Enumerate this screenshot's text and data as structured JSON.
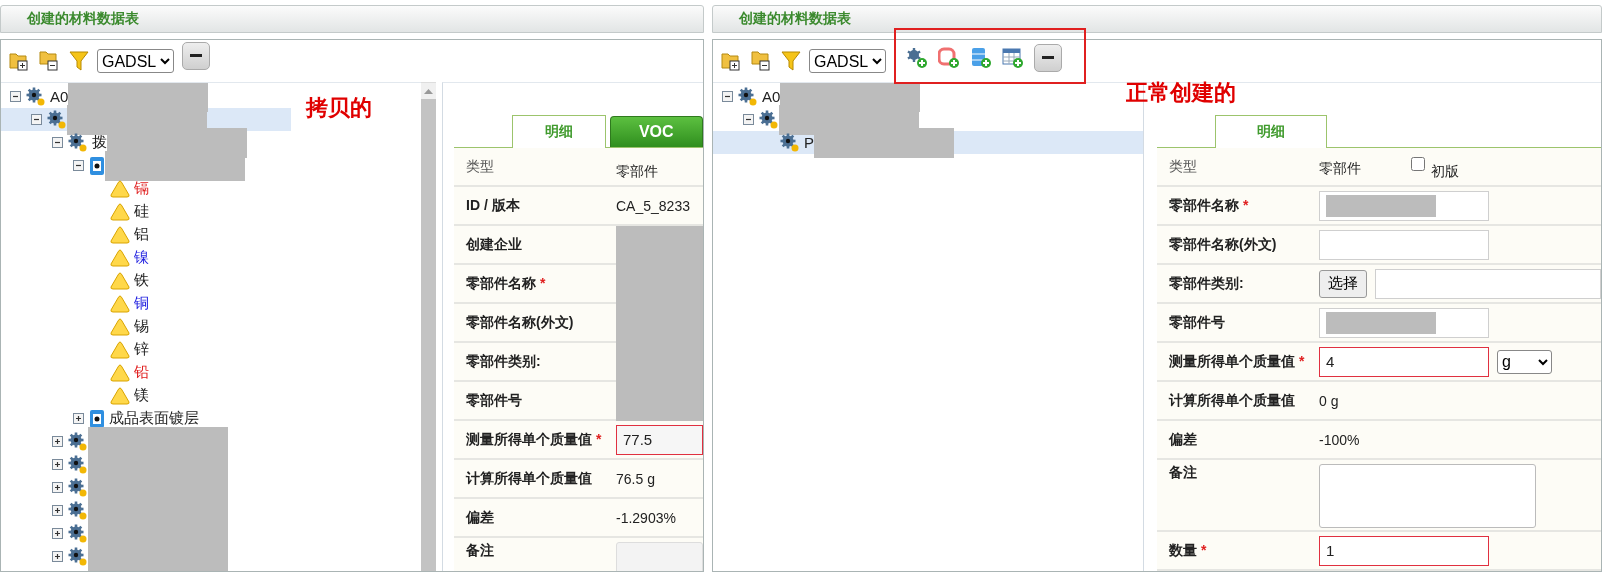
{
  "panels": [
    {
      "title": "创建的材料数据表",
      "toolbar": {
        "standard": "GADSL"
      },
      "annotation": "拷贝的",
      "scrollbar": true,
      "tree": [
        {
          "label": "A0",
          "kind": "assembly",
          "expanded": true,
          "redacted": true,
          "selected": false,
          "children": [
            {
              "kind": "assembly",
              "expanded": true,
              "redacted": true,
              "selected": true,
              "children": [
                {
                  "label": "拨",
                  "kind": "assembly",
                  "expanded": true,
                  "redacted": true,
                  "selected": false,
                  "children": [
                    {
                      "kind": "material",
                      "expanded": true,
                      "redacted": true,
                      "selected": false,
                      "children": [
                        {
                          "label": "镉",
                          "kind": "substance",
                          "color": "#e02020",
                          "selected": false
                        },
                        {
                          "label": "硅",
                          "kind": "substance",
                          "color": "#202020",
                          "selected": false
                        },
                        {
                          "label": "铝",
                          "kind": "substance",
                          "color": "#202020",
                          "selected": false
                        },
                        {
                          "label": "镍",
                          "kind": "substance",
                          "color": "#2020e0",
                          "selected": false
                        },
                        {
                          "label": "铁",
                          "kind": "substance",
                          "color": "#202020",
                          "selected": false
                        },
                        {
                          "label": "铜",
                          "kind": "substance",
                          "color": "#2020e0",
                          "selected": false
                        },
                        {
                          "label": "锡",
                          "kind": "substance",
                          "color": "#202020",
                          "selected": false
                        },
                        {
                          "label": "锌",
                          "kind": "substance",
                          "color": "#202020",
                          "selected": false
                        },
                        {
                          "label": "铅",
                          "kind": "substance",
                          "color": "#e02020",
                          "selected": false
                        },
                        {
                          "label": "镁",
                          "kind": "substance",
                          "color": "#202020",
                          "selected": false
                        }
                      ]
                    },
                    {
                      "label": "成品表面镀层",
                      "kind": "material",
                      "expanded": false,
                      "selected": false
                    }
                  ]
                },
                {
                  "kind": "assembly",
                  "expanded": false,
                  "redacted": true,
                  "selected": false
                },
                {
                  "kind": "assembly",
                  "expanded": false,
                  "redacted": true,
                  "selected": false
                },
                {
                  "kind": "assembly",
                  "expanded": false,
                  "redacted": true,
                  "selected": false
                },
                {
                  "kind": "assembly",
                  "expanded": false,
                  "redacted": true,
                  "selected": false
                },
                {
                  "kind": "assembly",
                  "expanded": false,
                  "redacted": true,
                  "selected": false
                },
                {
                  "kind": "assembly",
                  "expanded": false,
                  "redacted": true,
                  "selected": false
                }
              ]
            }
          ]
        }
      ],
      "tabs": [
        {
          "label": "明细",
          "selected": true
        },
        {
          "label": "VOC",
          "selected": false
        }
      ],
      "rows": [
        {
          "kind": "type",
          "label": "类型",
          "value": "零部件"
        },
        {
          "kind": "text",
          "label": "ID / 版本",
          "value": "CA_5_8233"
        },
        {
          "kind": "redacted",
          "label": "创建企业"
        },
        {
          "kind": "redacted",
          "label": "零部件名称",
          "required": "*"
        },
        {
          "kind": "redacted",
          "label": "零部件名称(外文)"
        },
        {
          "kind": "redacted",
          "label": "零部件类别:"
        },
        {
          "kind": "redacted",
          "label": "零部件号"
        },
        {
          "kind": "input",
          "label": "测量所得单个质量值",
          "required": "*",
          "value": "77.5",
          "invalid": true
        },
        {
          "kind": "text",
          "label": "计算所得单个质量值",
          "value": "76.5 g"
        },
        {
          "kind": "text",
          "label": "偏差",
          "value": "-1.2903%"
        },
        {
          "kind": "textarea",
          "label": "备注"
        }
      ]
    },
    {
      "title": "创建的材料数据表",
      "toolbar": {
        "standard": "GADSL",
        "add_tools": true
      },
      "annotation": "正常创建的",
      "tree": [
        {
          "label": "A0",
          "kind": "assembly",
          "expanded": true,
          "redacted": true,
          "selected": false,
          "children": [
            {
              "kind": "assembly",
              "expanded": true,
              "redacted": true,
              "selected": false,
              "children": [
                {
                  "label": "P",
                  "kind": "assembly",
                  "redacted": true,
                  "selected": true
                }
              ]
            }
          ]
        }
      ],
      "tabs": [
        {
          "label": "明细",
          "selected": true
        }
      ],
      "rows": [
        {
          "kind": "type",
          "label": "类型",
          "value": "零部件",
          "checkbox": {
            "label": "初版",
            "checked": false
          }
        },
        {
          "kind": "input",
          "label": "零部件名称",
          "required": "*",
          "invalid": false,
          "redacted": true
        },
        {
          "kind": "input",
          "label": "零部件名称(外文)",
          "invalid": false
        },
        {
          "kind": "picker",
          "label": "零部件类别:",
          "button": "选择"
        },
        {
          "kind": "input",
          "label": "零部件号",
          "invalid": false,
          "redacted": true
        },
        {
          "kind": "input",
          "label": "测量所得单个质量值",
          "required": "*",
          "value": "4",
          "invalid": true,
          "unit": "g"
        },
        {
          "kind": "text",
          "label": "计算所得单个质量值",
          "value": "0 g"
        },
        {
          "kind": "text",
          "label": "偏差",
          "value": "-100%"
        },
        {
          "kind": "textarea",
          "label": "备注"
        },
        {
          "kind": "input",
          "label": "数量",
          "required": "*",
          "value": "1",
          "invalid": true
        }
      ]
    }
  ]
}
